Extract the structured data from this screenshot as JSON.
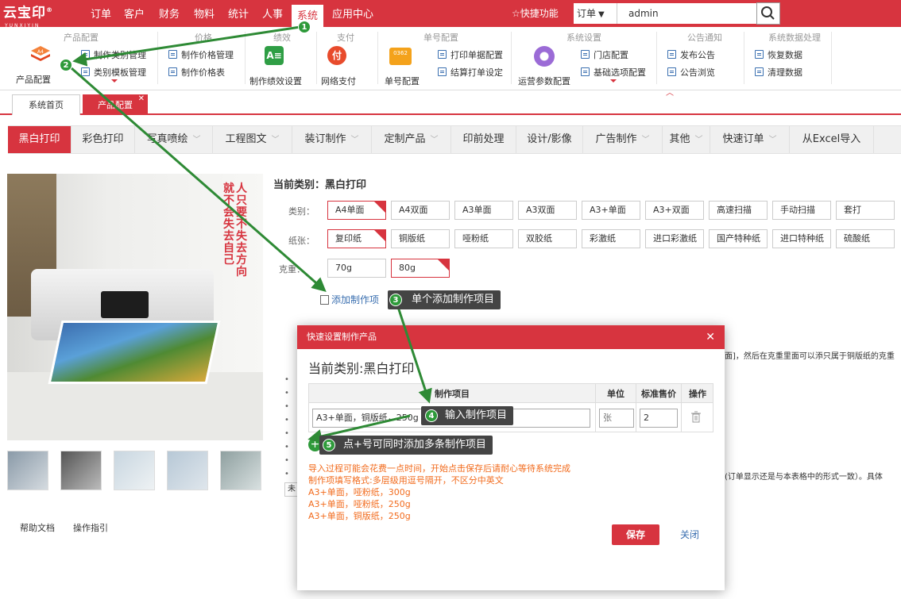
{
  "topbar": {
    "logo_text": "云宝印",
    "logo_sub": "YUNXIYIN",
    "menu": [
      "订单",
      "客户",
      "财务",
      "物料",
      "统计",
      "人事",
      "系统",
      "应用中心"
    ],
    "active_menu": "系统",
    "quick_label": "☆快捷功能",
    "order_dropdown": "订单",
    "search_value": "admin"
  },
  "ribbon": {
    "groups": {
      "product": "产品配置",
      "price": "价格",
      "perf": "绩效",
      "pay": "支付",
      "number": "单号配置",
      "system": "系统设置",
      "notice": "公告通知",
      "data": "系统数据处理"
    },
    "product_config": "产品配置",
    "product_items": [
      "制作类别管理",
      "类别模板管理"
    ],
    "price_items": [
      "制作价格管理",
      "制作价格表"
    ],
    "perf_item": "制作绩效设置",
    "pay_item": "网络支付",
    "number_big": "单号配置",
    "number_big_badge": "0362",
    "number_items": [
      "打印单据配置",
      "结算打单设定"
    ],
    "system_big": "运营参数配置",
    "system_items": [
      "门店配置",
      "基础选项配置"
    ],
    "notice_items": [
      "发布公告",
      "公告浏览"
    ],
    "data_items": [
      "恢复数据",
      "清理数据"
    ]
  },
  "tabs": [
    "系统首页",
    "产品配置"
  ],
  "categories": [
    "黑白打印",
    "彩色打印",
    "写真喷绘",
    "工程图文",
    "装订制作",
    "定制产品",
    "印前处理",
    "设计/影像",
    "广告制作",
    "其他",
    "快速订单",
    "从Excel导入"
  ],
  "image_text": [
    "人只要不失去方向",
    "就不会失去自己"
  ],
  "left_links": [
    "帮助文档",
    "操作指引"
  ],
  "content": {
    "current_label": "当前类别：黑白打印",
    "type_label": "类别：",
    "paper_label": "纸张：",
    "weight_label": "克重：",
    "types": [
      "A4单面",
      "A4双面",
      "A3单面",
      "A3双面",
      "A3+单面",
      "A3+双面",
      "高速扫描",
      "手动扫描",
      "套打"
    ],
    "papers": [
      "复印纸",
      "铜版纸",
      "哑粉纸",
      "双胶纸",
      "彩激纸",
      "进口彩激纸",
      "国产特种纸",
      "进口特种纸",
      "硫酸纸"
    ],
    "weights": [
      "70g",
      "80g"
    ],
    "default_mark": "默",
    "add_item": "添加制作项",
    "bg_text_right": "面]，然后在克重里面可以添只属于铜版纸的克重",
    "bg_text_right2": "(订单显示还是与本表格中的形式一致）。具体",
    "bg_btn": "未"
  },
  "callouts": {
    "c1": "1",
    "c2": "2",
    "c3": "单个添加制作项目",
    "c4": "输入制作项目",
    "c5": "点+号可同时添加多条制作项目",
    "n3": "3",
    "n4": "4",
    "n5": "5"
  },
  "modal": {
    "title": "快速设置制作产品",
    "close": "✕",
    "current": "当前类别:黑白打印",
    "headers": [
      "制作项目",
      "单位",
      "标准售价",
      "操作"
    ],
    "row": {
      "item": "A3+单面，铜版纸，250g",
      "unit": "张",
      "price": "2"
    },
    "notes": [
      "导入过程可能会花费一点时间，开始点击保存后请耐心等待系统完成",
      "制作项填写格式:多层级用逗号隔开，不区分中英文",
      "A3+单面，哑粉纸，300g",
      "A3+单面，哑粉纸，250g",
      "A3+单面，铜版纸，250g"
    ],
    "save": "保存",
    "cancel": "关闭"
  }
}
